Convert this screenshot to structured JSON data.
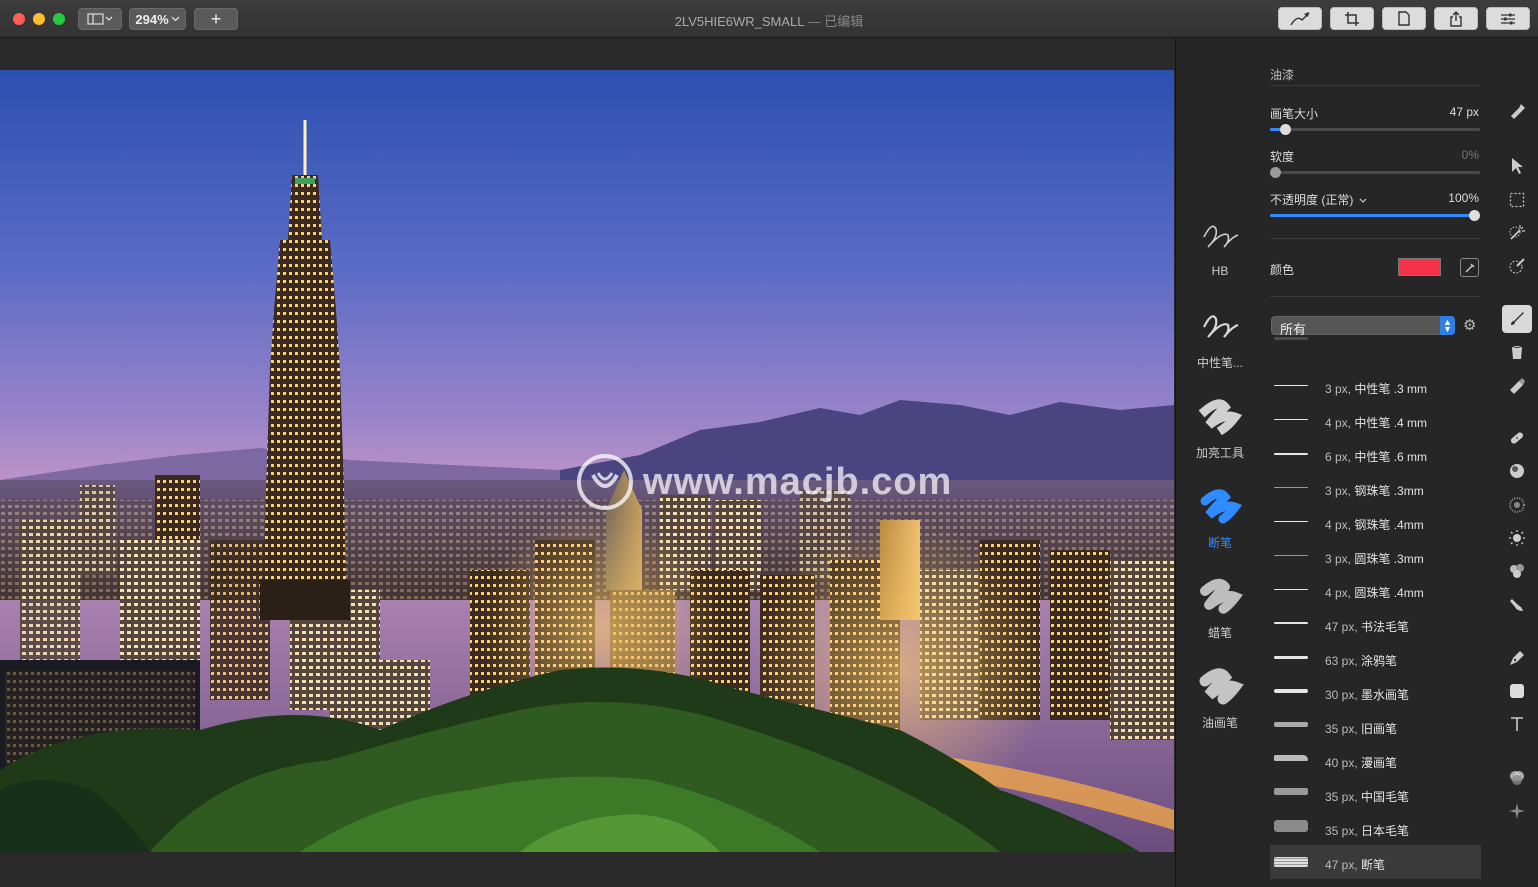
{
  "window": {
    "title": "2LV5HIE6WR_SMALL",
    "subtitle": "— 已编辑",
    "zoom": "294%",
    "add": "+"
  },
  "canvas": {
    "watermark": "www.macjb.com"
  },
  "panel": {
    "section_title": "油漆",
    "brush_size": {
      "label": "画笔大小",
      "value": "47 px",
      "level": 0.07
    },
    "softness": {
      "label": "软度",
      "value": "0%",
      "level": 0.0
    },
    "opacity": {
      "label": "不透明度 (正常)",
      "value": "100%",
      "level": 1.0
    },
    "color": {
      "label": "颜色",
      "hex": "#f5324a"
    },
    "filter": {
      "selected": "所有"
    },
    "brush_types": [
      {
        "label": "HB",
        "active": false
      },
      {
        "label": "中性笔...",
        "active": false
      },
      {
        "label": "加亮工具",
        "active": false
      },
      {
        "label": "断笔",
        "active": true
      },
      {
        "label": "蜡笔",
        "active": false
      },
      {
        "label": "油画笔",
        "active": false
      }
    ],
    "presets": [
      {
        "size": "3 px,",
        "name": "中性笔 .3 mm"
      },
      {
        "size": "4 px,",
        "name": "中性笔 .4 mm"
      },
      {
        "size": "6 px,",
        "name": "中性笔 .6 mm"
      },
      {
        "size": "3 px,",
        "name": "钢珠笔 .3mm"
      },
      {
        "size": "4 px,",
        "name": "钢珠笔 .4mm"
      },
      {
        "size": "3 px,",
        "name": "圆珠笔 .3mm"
      },
      {
        "size": "4 px,",
        "name": "圆珠笔 .4mm"
      },
      {
        "size": "47 px,",
        "name": "书法毛笔"
      },
      {
        "size": "63 px,",
        "name": "涂鸦笔"
      },
      {
        "size": "30 px,",
        "name": "墨水画笔"
      },
      {
        "size": "35 px,",
        "name": "旧画笔"
      },
      {
        "size": "40 px,",
        "name": "漫画笔"
      },
      {
        "size": "35 px,",
        "name": "中国毛笔"
      },
      {
        "size": "35 px,",
        "name": "日本毛笔"
      },
      {
        "size": "47 px,",
        "name": "断笔"
      }
    ]
  },
  "tools": [
    "stamp-tool-icon",
    "arrow-tool-icon",
    "rect-select-icon",
    "magic-wand-icon",
    "quick-select-icon",
    "paint-brush-icon",
    "bucket-icon",
    "eraser-icon",
    "bandage-icon",
    "clone-icon",
    "blur-icon",
    "sun-icon",
    "sponge-icon",
    "smudge-icon",
    "pen-icon",
    "shape-icon",
    "text-icon",
    "color-adjust-icon",
    "sparkle-icon"
  ],
  "colors": {
    "accent": "#2f8bff",
    "panel": "#262626",
    "titlebar": "#363636"
  }
}
